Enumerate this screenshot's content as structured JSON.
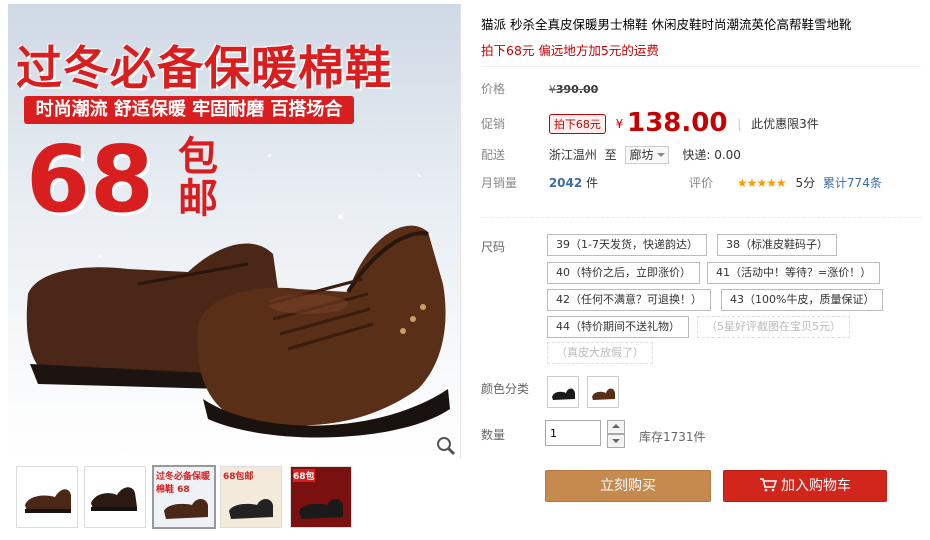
{
  "gallery": {
    "promo_title": "过冬必备保暖棉鞋",
    "promo_banner": "时尚潮流  舒适保暖  牢固耐磨  百搭场合",
    "badge_number": "68",
    "badge_suffix": "包邮",
    "thumbnails": [
      {
        "label": ""
      },
      {
        "label": ""
      },
      {
        "label": "过冬必备保暖棉鞋 68"
      },
      {
        "label": "68包邮"
      },
      {
        "label": "68包"
      }
    ],
    "active_thumbnail": 2
  },
  "product": {
    "title": "猫派 秒杀全真皮保暖男士棉鞋 休闲皮鞋时尚潮流英伦高帮鞋雪地靴",
    "subtitle": "拍下68元 偏远地方加5元的运费"
  },
  "price_row": {
    "label": "价格",
    "currency": "¥",
    "original": "390.00"
  },
  "promo_row": {
    "label": "促销",
    "tag": "拍下68元",
    "currency": "¥",
    "price": "138.00",
    "limit": "此优惠限3件"
  },
  "shipping_row": {
    "label": "配送",
    "origin": "浙江温州",
    "to": "至",
    "destination": "廊坊",
    "express": "快递: 0.00"
  },
  "sales_row": {
    "label": "月销量",
    "count": "2042",
    "unit": "件"
  },
  "rating_row": {
    "label": "评价",
    "stars": "★★★★★",
    "score": "5分",
    "total": "累计774条"
  },
  "size": {
    "label": "尺码",
    "options": [
      {
        "text": "39（1-7天发货，快递韵达）",
        "disabled": false
      },
      {
        "text": "38（标准皮鞋码子）",
        "disabled": false
      },
      {
        "text": "40（特价之后，立即涨价）",
        "disabled": false
      },
      {
        "text": "41（活动中！等待？=涨价！）",
        "disabled": false
      },
      {
        "text": "42（任何不满意？可退换！）",
        "disabled": false
      },
      {
        "text": "43（100%牛皮，质量保证）",
        "disabled": false
      },
      {
        "text": "44（特价期间不送礼物）",
        "disabled": false
      },
      {
        "text": "（5星好评截图在宝贝5元）",
        "disabled": true
      },
      {
        "text": "（真皮大放假了）",
        "disabled": true
      }
    ]
  },
  "color": {
    "label": "颜色分类",
    "options": [
      {
        "name": "black-shoe"
      },
      {
        "name": "brown-shoe"
      }
    ]
  },
  "quantity": {
    "label": "数量",
    "value": "1",
    "stock": "库存1731件"
  },
  "actions": {
    "buy_now": "立刻购买",
    "add_to_cart": "加入购物车"
  },
  "colors": {
    "accent": "#c40000",
    "buy_button": "#c68a4f",
    "cart_button": "#d2261c",
    "star": "#ff9900"
  },
  "icons": [
    "zoom-icon",
    "cart-icon",
    "caret-down-icon",
    "star-icon"
  ]
}
